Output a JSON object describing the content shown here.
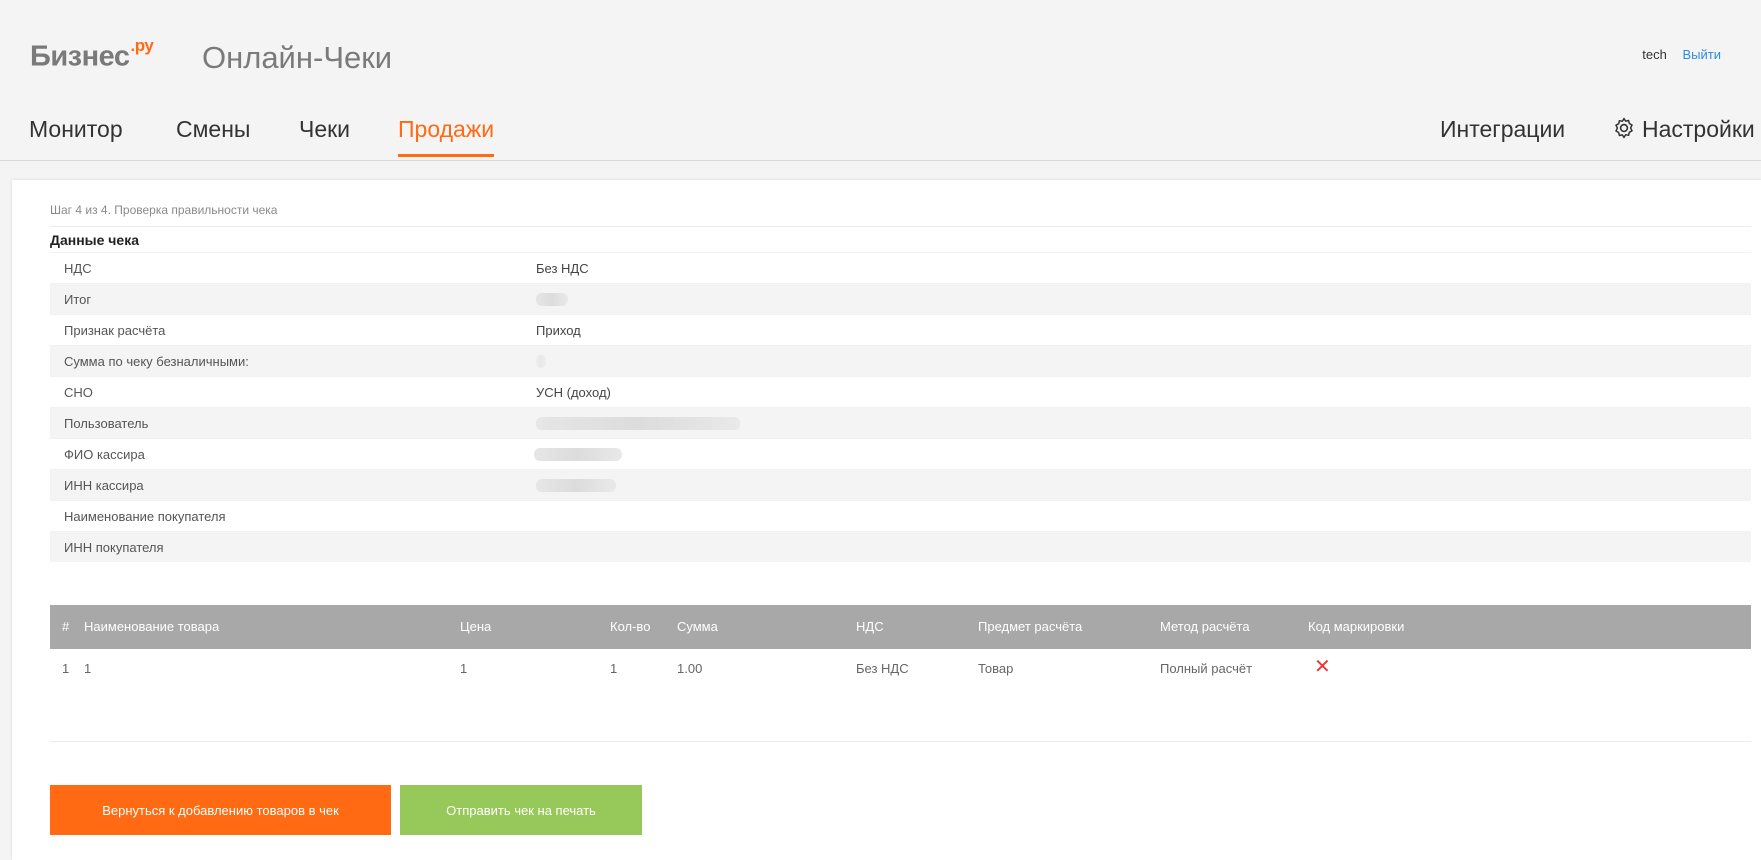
{
  "header": {
    "logo_text": "Бизнес",
    "logo_sup": ".ру",
    "app_title": "Онлайн-Чеки",
    "user_name": "tech",
    "logout_label": "Выйти"
  },
  "nav": {
    "monitor": "Монитор",
    "shifts": "Смены",
    "receipts": "Чеки",
    "sales": "Продажи",
    "integrations": "Интеграции",
    "settings": "Настройки"
  },
  "main": {
    "step": "Шаг 4 из 4. Проверка правильности чека",
    "section_title": "Данные чека",
    "details": [
      {
        "label": "НДС",
        "value": "Без НДС"
      },
      {
        "label": "Итог",
        "value": ""
      },
      {
        "label": "Признак расчёта",
        "value": "Приход"
      },
      {
        "label": "Сумма по чеку безналичными:",
        "value": ""
      },
      {
        "label": "СНО",
        "value": "УСН (доход)"
      },
      {
        "label": "Пользователь",
        "value": ""
      },
      {
        "label": "ФИО кассира",
        "value": ""
      },
      {
        "label": "ИНН кассира",
        "value": ""
      },
      {
        "label": "Наименование покупателя",
        "value": ""
      },
      {
        "label": "ИНН покупателя",
        "value": ""
      }
    ],
    "table": {
      "headers": {
        "num": "#",
        "name": "Наименование товара",
        "price": "Цена",
        "qty": "Кол-во",
        "sum": "Сумма",
        "vat": "НДС",
        "subject": "Предмет расчёта",
        "method": "Метод расчёта",
        "marking": "Код маркировки"
      },
      "rows": [
        {
          "num": "1",
          "name": "1",
          "price": "1",
          "qty": "1",
          "sum": "1.00",
          "vat": "Без НДС",
          "subject": "Товар",
          "method": "Полный расчёт",
          "marking": "✕"
        }
      ]
    },
    "buttons": {
      "back": "Вернуться к добавлению товаров в чек",
      "print": "Отправить чек на печать"
    }
  },
  "colors": {
    "accent": "#ff6a13",
    "print_button": "#97c85a",
    "table_header": "#a8a8a8",
    "link": "#2d8ce0"
  }
}
